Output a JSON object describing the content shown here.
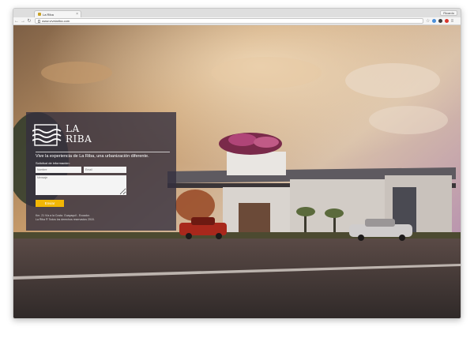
{
  "browser": {
    "tab_title": "La Riba",
    "tab_close": "×",
    "profile_label": "Ricardo",
    "nav_back": "←",
    "nav_forward": "→",
    "nav_reload": "↻",
    "address": "www.vivelariba.com",
    "star": "☆",
    "extension_colors": [
      "#4a8fd9",
      "#3c3c3c",
      "#d9352b"
    ]
  },
  "page": {
    "logo": {
      "line1": "LA",
      "line2": "RIBA"
    },
    "tagline": "Vive la experiencia de La Riba, una urbanización diferente.",
    "form": {
      "title": "Solicitud de información:",
      "name_placeholder": "Nombre",
      "email_placeholder": "Email",
      "message_placeholder": "Mensaje",
      "submit_label": "Enviar"
    },
    "footer": {
      "address": "Km. 21 Vía a la Costa. Guayaquil - Ecuador.",
      "copyright": "La Riba ® Todos los derechos reservados 2015."
    },
    "colors": {
      "accent": "#f2b705",
      "panel": "#34303e"
    }
  }
}
